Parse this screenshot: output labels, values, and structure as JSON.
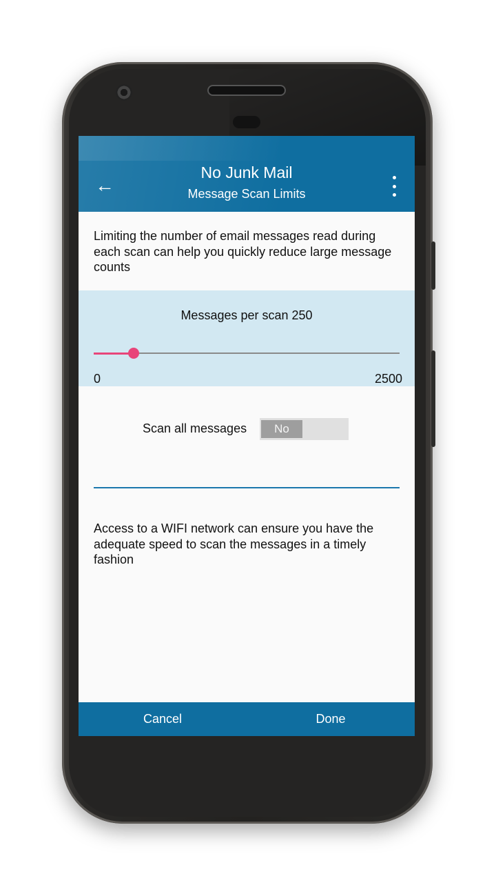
{
  "app": {
    "title": "No Junk Mail",
    "subtitle": "Message Scan Limits",
    "back_icon": "arrow-left-icon",
    "menu_icon": "more-vertical-icon",
    "primary_color": "#0f6ea0",
    "accent_color": "#e8457a"
  },
  "intro_text": "Limiting the number of email messages read during each scan can help you quickly reduce large message counts",
  "slider": {
    "label": "Messages per scan 250",
    "min_label": "0",
    "max_label": "2500",
    "min": 0,
    "max": 2500,
    "value": 250
  },
  "scan_all": {
    "label": "Scan all messages",
    "toggle_text": "No",
    "checked": false
  },
  "wifi_text": "Access to a WIFI network can ensure you have the adequate speed to scan the messages in a timely fashion",
  "footer": {
    "cancel_label": "Cancel",
    "done_label": "Done"
  }
}
